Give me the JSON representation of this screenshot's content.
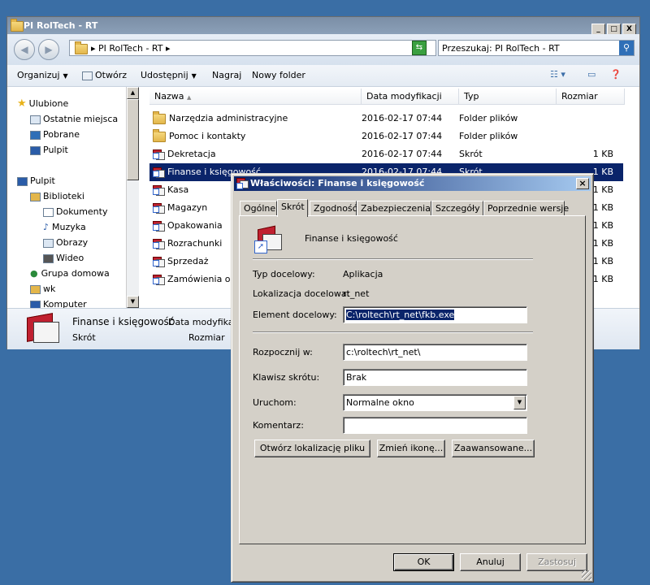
{
  "explorer": {
    "title": "PI RolTech - RT",
    "window_buttons": [
      "_",
      "□",
      "X"
    ],
    "address": "▸ PI RolTech - RT ▸",
    "search_placeholder": "Przeszukaj: PI RolTech - RT",
    "toolbar": {
      "organize": "Organizuj",
      "open": "Otwórz",
      "share": "Udostępnij",
      "burn": "Nagraj",
      "new_folder": "Nowy folder"
    },
    "sidebar": [
      {
        "label": "Ulubione",
        "icon": "star-icon"
      },
      {
        "label": "Ostatnie miejsca",
        "icon": "recent-places-icon"
      },
      {
        "label": "Pobrane",
        "icon": "downloads-icon"
      },
      {
        "label": "Pulpit",
        "icon": "desktop-icon"
      },
      {
        "label": "Pulpit",
        "icon": "desktop-icon"
      },
      {
        "label": "Biblioteki",
        "icon": "libraries-icon"
      },
      {
        "label": "Dokumenty",
        "icon": "documents-icon"
      },
      {
        "label": "Muzyka",
        "icon": "music-icon"
      },
      {
        "label": "Obrazy",
        "icon": "pictures-icon"
      },
      {
        "label": "Wideo",
        "icon": "video-icon"
      },
      {
        "label": "Grupa domowa",
        "icon": "homegroup-icon"
      },
      {
        "label": "wk",
        "icon": "user-folder-icon"
      },
      {
        "label": "Komputer",
        "icon": "computer-icon"
      }
    ],
    "columns": {
      "name": "Nazwa",
      "date": "Data modyfikacji",
      "type": "Typ",
      "size": "Rozmiar"
    },
    "rows": [
      {
        "name": "Narzędzia administracyjne",
        "date": "2016-02-17 07:44",
        "type": "Folder plików",
        "size": "",
        "icon": "folder-icon"
      },
      {
        "name": "Pomoc i kontakty",
        "date": "2016-02-17 07:44",
        "type": "Folder plików",
        "size": "",
        "icon": "folder-icon"
      },
      {
        "name": "Dekretacja",
        "date": "2016-02-17 07:44",
        "type": "Skrót",
        "size": "1 KB",
        "icon": "shortcut-icon"
      },
      {
        "name": "Finanse i księgowość",
        "date": "2016-02-17 07:44",
        "type": "Skrót",
        "size": "1 KB",
        "icon": "shortcut-icon"
      },
      {
        "name": "Kasa",
        "date": "",
        "type": "",
        "size": "1 KB",
        "icon": "shortcut-icon"
      },
      {
        "name": "Magazyn",
        "date": "",
        "type": "",
        "size": "1 KB",
        "icon": "shortcut-icon"
      },
      {
        "name": "Opakowania",
        "date": "",
        "type": "",
        "size": "1 KB",
        "icon": "shortcut-icon"
      },
      {
        "name": "Rozrachunki",
        "date": "",
        "type": "",
        "size": "1 KB",
        "icon": "shortcut-icon"
      },
      {
        "name": "Sprzedaż",
        "date": "",
        "type": "",
        "size": "1 KB",
        "icon": "shortcut-icon"
      },
      {
        "name": "Zamówienia od c",
        "date": "",
        "type": "",
        "size": "1 KB",
        "icon": "shortcut-icon"
      }
    ],
    "details": {
      "name": "Finanse i księgowość",
      "date_label": "Data modyfikacji",
      "type": "Skrót",
      "size_label": "Rozmiar"
    }
  },
  "dialog": {
    "title": "Właściwości: Finanse i księgowość",
    "close": "×",
    "tabs": [
      "Ogólne",
      "Skrót",
      "Zgodność",
      "Zabezpieczenia",
      "Szczegóły",
      "Poprzednie wersje"
    ],
    "active_tab": "Skrót",
    "shortcut_name": "Finanse i księgowość",
    "target_type_label": "Typ docelowy:",
    "target_type": "Aplikacja",
    "target_location_label": "Lokalizacja docelowa:",
    "target_location": "rt_net",
    "target_label": "Element docelowy:",
    "target": "C:\\roltech\\rt_net\\fkb.exe",
    "start_in_label": "Rozpocznij w:",
    "start_in": "c:\\roltech\\rt_net\\",
    "hotkey_label": "Klawisz skrótu:",
    "hotkey": "Brak",
    "run_label": "Uruchom:",
    "run": "Normalne okno",
    "comment_label": "Komentarz:",
    "comment": "",
    "open_location": "Otwórz lokalizację pliku",
    "change_icon": "Zmień ikonę...",
    "advanced": "Zaawansowane...",
    "ok": "OK",
    "cancel": "Anuluj",
    "apply": "Zastosuj"
  }
}
